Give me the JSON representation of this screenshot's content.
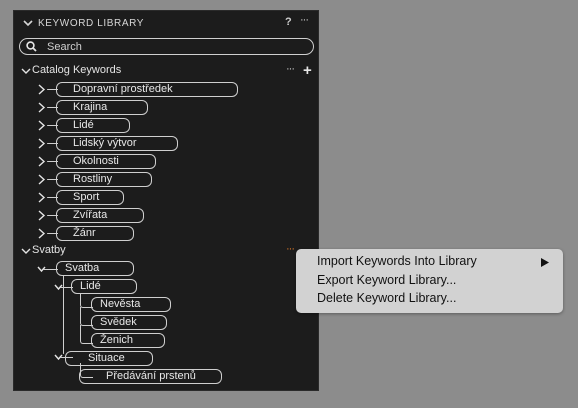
{
  "panel": {
    "title": "KEYWORD LIBRARY",
    "help_label": "?",
    "more_label": "···",
    "search_placeholder": "Search"
  },
  "catalog": {
    "title": "Catalog Keywords",
    "more_label": "···",
    "add_label": "+",
    "items": [
      {
        "label": "Dopravní prostředek"
      },
      {
        "label": "Krajina"
      },
      {
        "label": "Lidé"
      },
      {
        "label": "Lidský výtvor"
      },
      {
        "label": "Okolnosti"
      },
      {
        "label": "Rostliny"
      },
      {
        "label": "Sport"
      },
      {
        "label": "Zvířata"
      },
      {
        "label": "Žánr"
      }
    ]
  },
  "svatby": {
    "title": "Svatby",
    "more_label": "···",
    "tree": {
      "root": "Svatba",
      "lide": "Lidé",
      "lide_children": [
        "Nevěsta",
        "Svědek",
        "Ženich"
      ],
      "situace": "Situace",
      "situace_children": [
        "Předávání prstenů"
      ]
    }
  },
  "context_menu": {
    "items": [
      {
        "label": "Import Keywords Into Library",
        "has_submenu": true
      },
      {
        "label": "Export Keyword Library..."
      },
      {
        "label": "Delete Keyword Library..."
      }
    ]
  },
  "colors": {
    "background": "#8c8c8c",
    "panel": "#1c1c1c",
    "accent_more": "#e07b2a",
    "menu": "#d2d2d2"
  }
}
